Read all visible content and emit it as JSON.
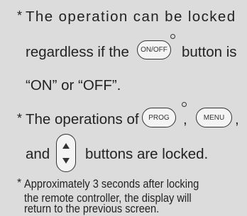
{
  "bullet": "*",
  "item1": {
    "line1": "The operation can be locked",
    "line2a": "regardless if the",
    "button": "ON/OFF",
    "line2b": "button is",
    "line3": "“ON” or “OFF”."
  },
  "item2": {
    "line1": "The operations of",
    "prog": "PROG",
    "comma1": ",",
    "menu": "MENU",
    "comma2": ",",
    "and": "and",
    "rest": "buttons are locked."
  },
  "item3": {
    "line1": "Approximately 3 seconds after locking",
    "line2": "the remote controller, the display will",
    "line3": "return to the previous screen."
  }
}
